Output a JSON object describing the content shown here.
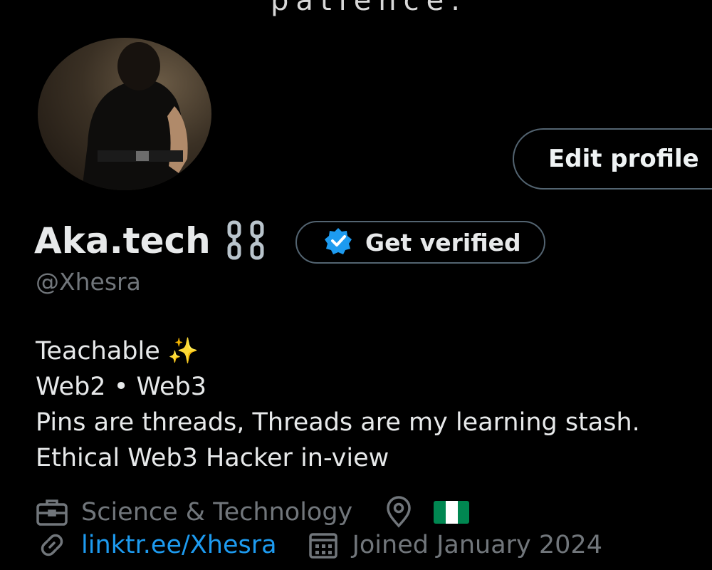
{
  "banner": {
    "cut_text": "patience."
  },
  "profile": {
    "display_name": "Aka.tech",
    "handle": "@Xhesra",
    "name_emoji_icon": "chain-icon",
    "edit_button_label": "Edit profile",
    "verify_button_label": "Get verified",
    "verify_badge_color": "#1d9bf0"
  },
  "bio": {
    "line1": "Teachable ✨",
    "line2": "Web2 • Web3",
    "line3": "Pins are threads, Threads are my learning stash.",
    "line4": "Ethical Web3 Hacker in-view"
  },
  "meta": {
    "category": "Science & Technology",
    "location_flag": "Nigeria flag",
    "link": "linktr.ee/Xhesra",
    "joined": "Joined January 2024"
  },
  "colors": {
    "background": "#000000",
    "text": "#e7e9ea",
    "muted": "#71767b",
    "border": "#536471",
    "link": "#1d9bf0",
    "flag_green": "#008751",
    "flag_white": "#ffffff"
  }
}
